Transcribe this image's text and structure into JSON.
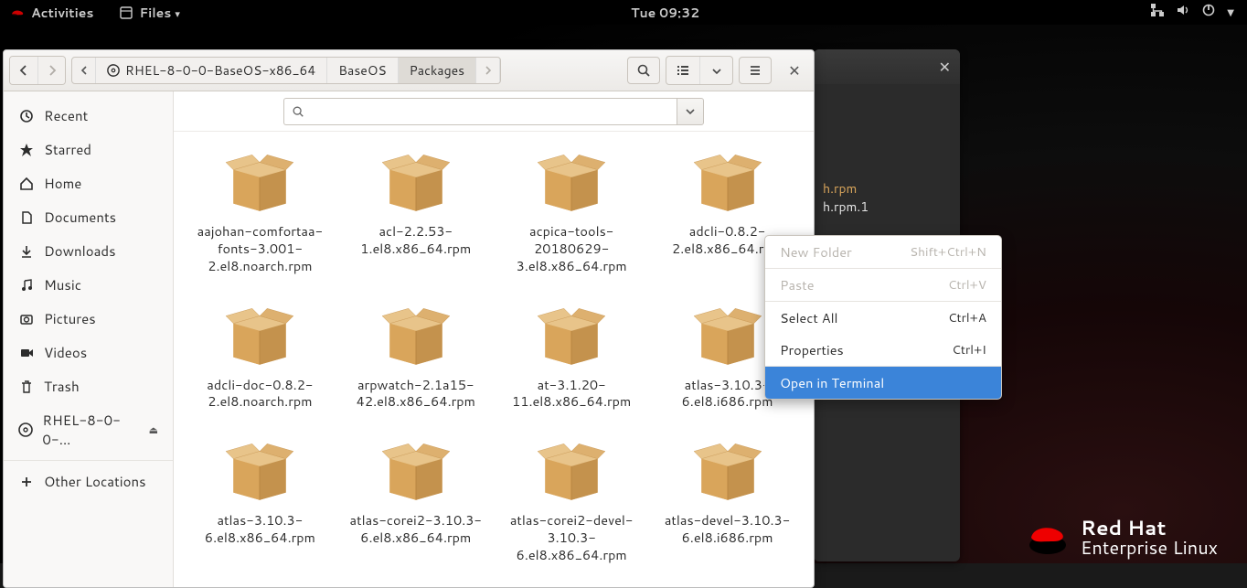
{
  "panel": {
    "activities": "Activities",
    "app_menu": "Files",
    "clock": "Tue 09:32"
  },
  "terminal": {
    "line1": "h.rpm",
    "line2": "h.rpm.1"
  },
  "rh_logo": {
    "l1": "Red Hat",
    "l2": "Enterprise Linux"
  },
  "files": {
    "path": {
      "seg1": "RHEL-8-0-0-BaseOS-x86_64",
      "seg2": "BaseOS",
      "seg3": "Packages"
    },
    "sidebar": {
      "recent": "Recent",
      "starred": "Starred",
      "home": "Home",
      "documents": "Documents",
      "downloads": "Downloads",
      "music": "Music",
      "pictures": "Pictures",
      "videos": "Videos",
      "trash": "Trash",
      "device": "RHEL-8-0-0-...",
      "other": "Other Locations"
    },
    "items": {
      "i0": "aajohan-comfortaa-fonts-3.001-2.el8.noarch.rpm",
      "i1": "acl-2.2.53-1.el8.x86_64.rpm",
      "i2": "acpica-tools-20180629-3.el8.x86_64.rpm",
      "i3": "adcli-0.8.2-2.el8.x86_64.rpm",
      "i4": "adcli-doc-0.8.2-2.el8.noarch.rpm",
      "i5": "arpwatch-2.1a15-42.el8.x86_64.rpm",
      "i6": "at-3.1.20-11.el8.x86_64.rpm",
      "i7": "atlas-3.10.3-6.el8.i686.rpm",
      "i8": "atlas-3.10.3-6.el8.x86_64.rpm",
      "i9": "atlas-corei2-3.10.3-6.el8.x86_64.rpm",
      "i10": "atlas-corei2-devel-3.10.3-6.el8.x86_64.rpm",
      "i11": "atlas-devel-3.10.3-6.el8.i686.rpm"
    }
  },
  "ctx": {
    "new_folder": "New Folder",
    "new_folder_k": "Shift+Ctrl+N",
    "paste": "Paste",
    "paste_k": "Ctrl+V",
    "select_all": "Select All",
    "select_all_k": "Ctrl+A",
    "properties": "Properties",
    "properties_k": "Ctrl+I",
    "open_terminal": "Open in Terminal"
  }
}
